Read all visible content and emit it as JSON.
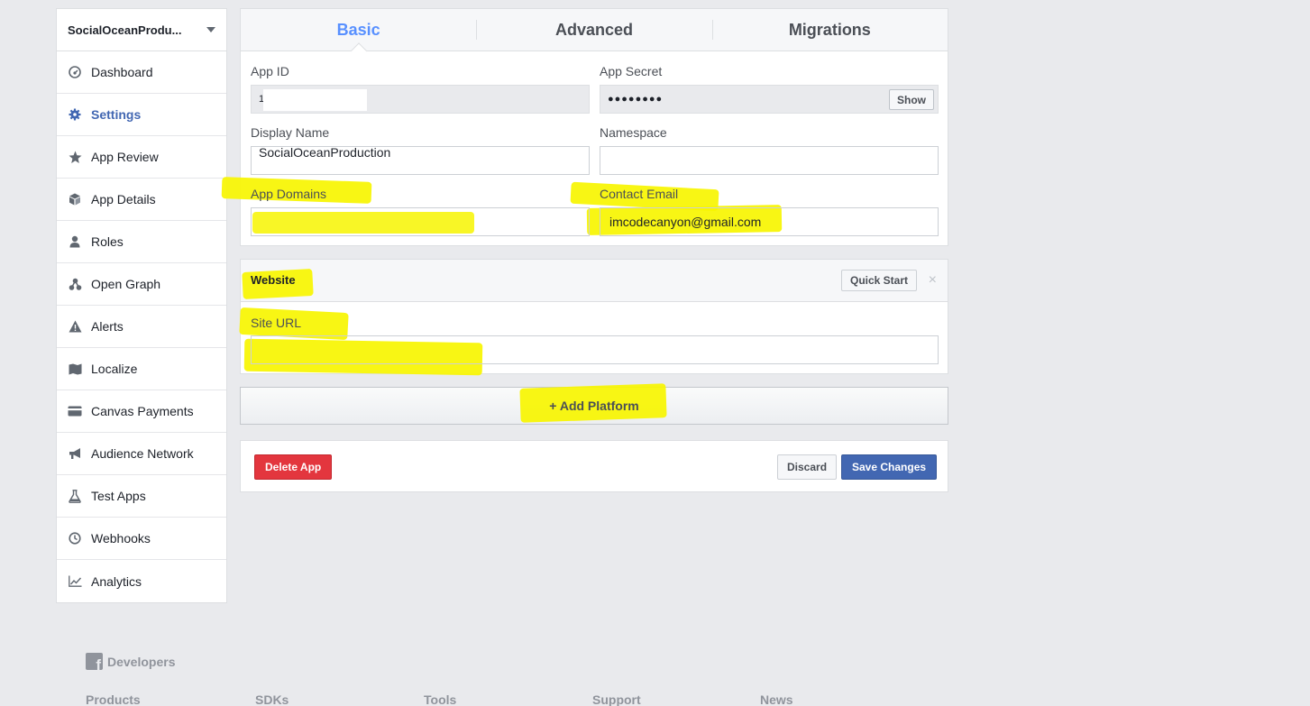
{
  "sidebar": {
    "app_name": "SocialOceanProdu...",
    "items": [
      {
        "label": "Dashboard",
        "icon": "dashboard-icon"
      },
      {
        "label": "Settings",
        "icon": "gear-icon",
        "active": true
      },
      {
        "label": "App Review",
        "icon": "star-icon"
      },
      {
        "label": "App Details",
        "icon": "cube-icon"
      },
      {
        "label": "Roles",
        "icon": "person-icon"
      },
      {
        "label": "Open Graph",
        "icon": "graph-nodes-icon"
      },
      {
        "label": "Alerts",
        "icon": "warning-icon"
      },
      {
        "label": "Localize",
        "icon": "map-icon"
      },
      {
        "label": "Canvas Payments",
        "icon": "credit-card-icon"
      },
      {
        "label": "Audience Network",
        "icon": "megaphone-icon"
      },
      {
        "label": "Test Apps",
        "icon": "flask-icon"
      },
      {
        "label": "Webhooks",
        "icon": "clock-icon"
      },
      {
        "label": "Analytics",
        "icon": "chart-line-icon"
      }
    ]
  },
  "tabs": [
    {
      "label": "Basic",
      "active": true
    },
    {
      "label": "Advanced"
    },
    {
      "label": "Migrations"
    }
  ],
  "basic": {
    "app_id_label": "App ID",
    "app_id_value": "1",
    "app_secret_label": "App Secret",
    "app_secret_value": "●●●●●●●●",
    "show_label": "Show",
    "display_name_label": "Display Name",
    "display_name_value": "SocialOceanProduction",
    "namespace_label": "Namespace",
    "namespace_value": "",
    "app_domains_label": "App Domains",
    "app_domains_value": "",
    "contact_email_label": "Contact Email",
    "contact_email_value": "imcodecanyon@gmail.com"
  },
  "website": {
    "title": "Website",
    "quick_start_label": "Quick Start",
    "close_glyph": "×",
    "site_url_label": "Site URL",
    "site_url_value": ""
  },
  "add_platform_label": "+ Add Platform",
  "actions": {
    "delete_label": "Delete App",
    "discard_label": "Discard",
    "save_label": "Save Changes"
  },
  "footer": {
    "brand": "Developers",
    "columns": [
      "Products",
      "SDKs",
      "Tools",
      "Support",
      "News"
    ]
  },
  "colors": {
    "accent": "#4267b2",
    "active_tab": "#5890ff",
    "delete": "#e3363e",
    "highlight": "#f7f500",
    "background": "#e9eaed"
  }
}
